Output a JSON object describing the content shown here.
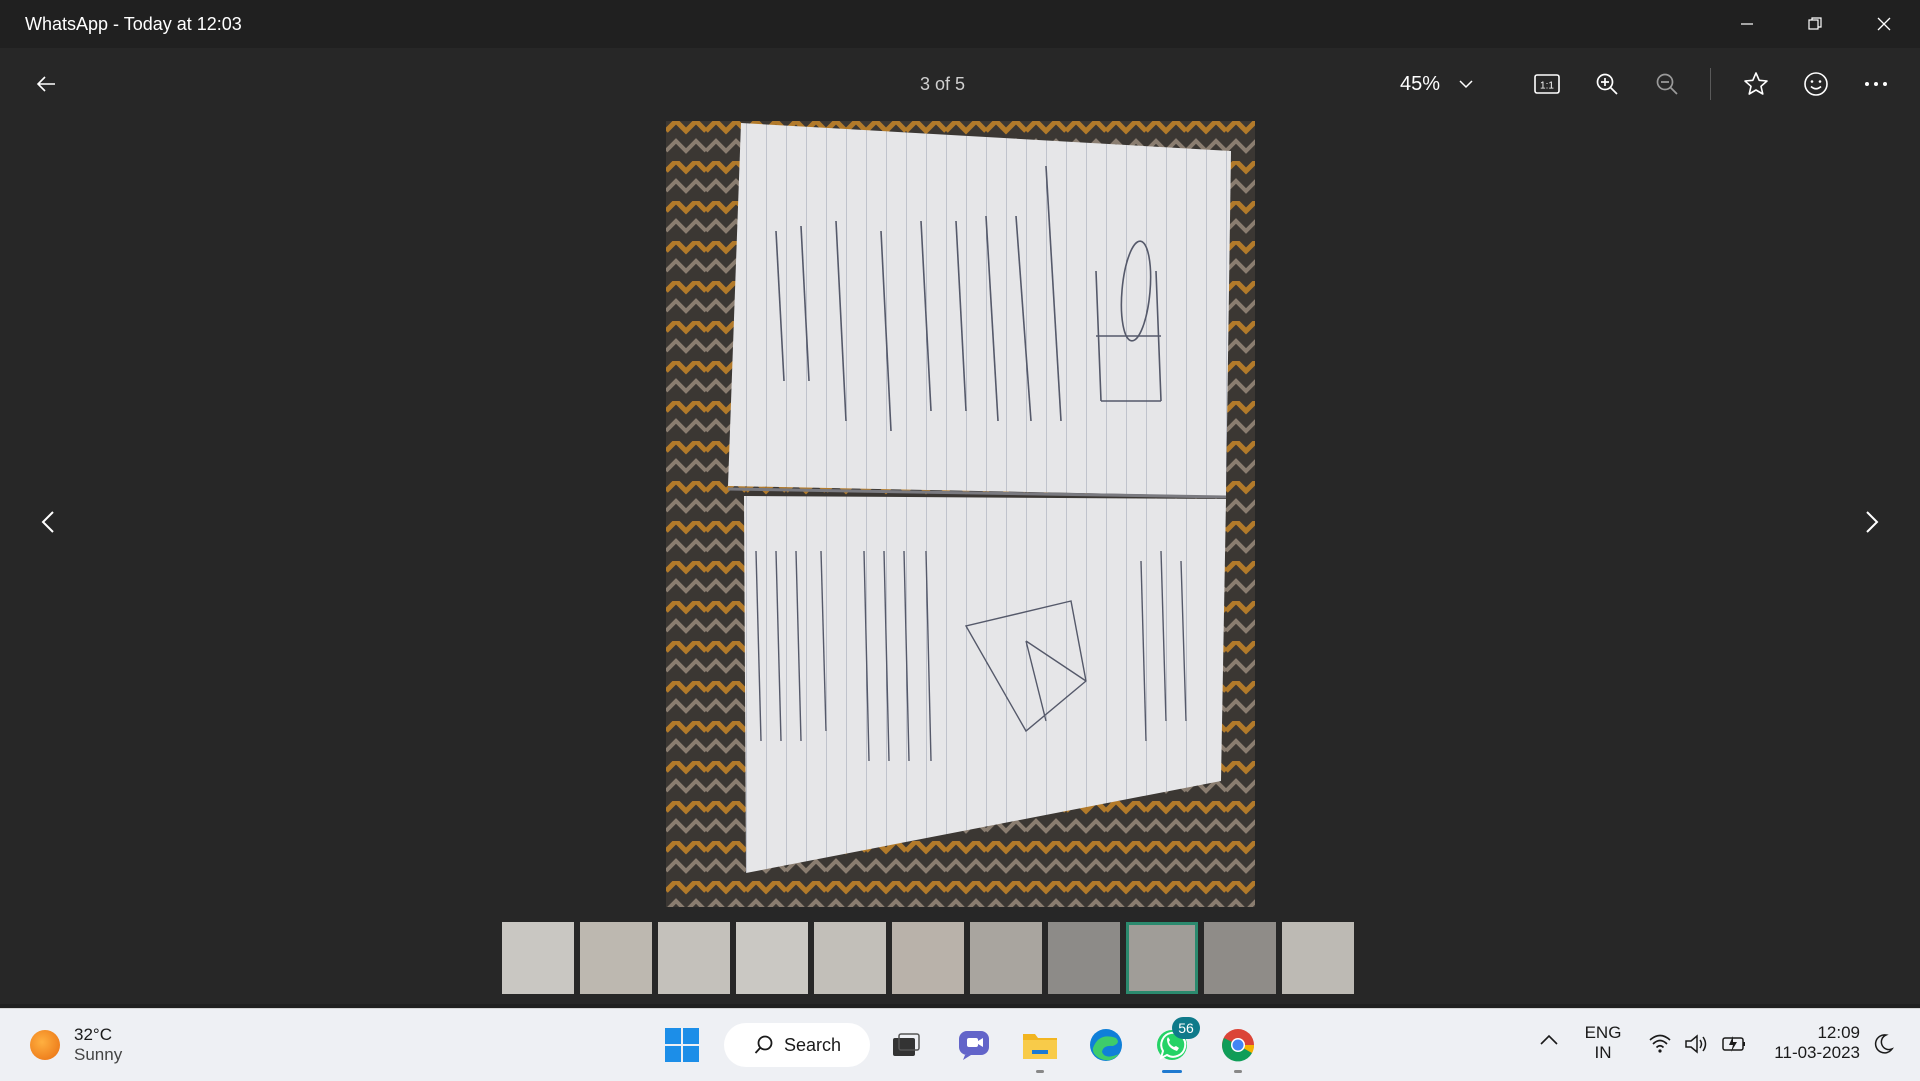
{
  "window": {
    "title": "WhatsApp - Today at 12:03"
  },
  "toolbar": {
    "counter": "3 of 5",
    "zoom": "45%"
  },
  "photo": {
    "alt": "Photo of an open notebook page"
  },
  "filmstrip": {
    "count": 11,
    "selected_index": 8
  },
  "taskbar": {
    "weather_temp": "32°C",
    "weather_desc": "Sunny",
    "search_label": "Search",
    "whatsapp_badge": "56",
    "lang_top": "ENG",
    "lang_bottom": "IN",
    "time": "12:09",
    "date": "11-03-2023"
  }
}
